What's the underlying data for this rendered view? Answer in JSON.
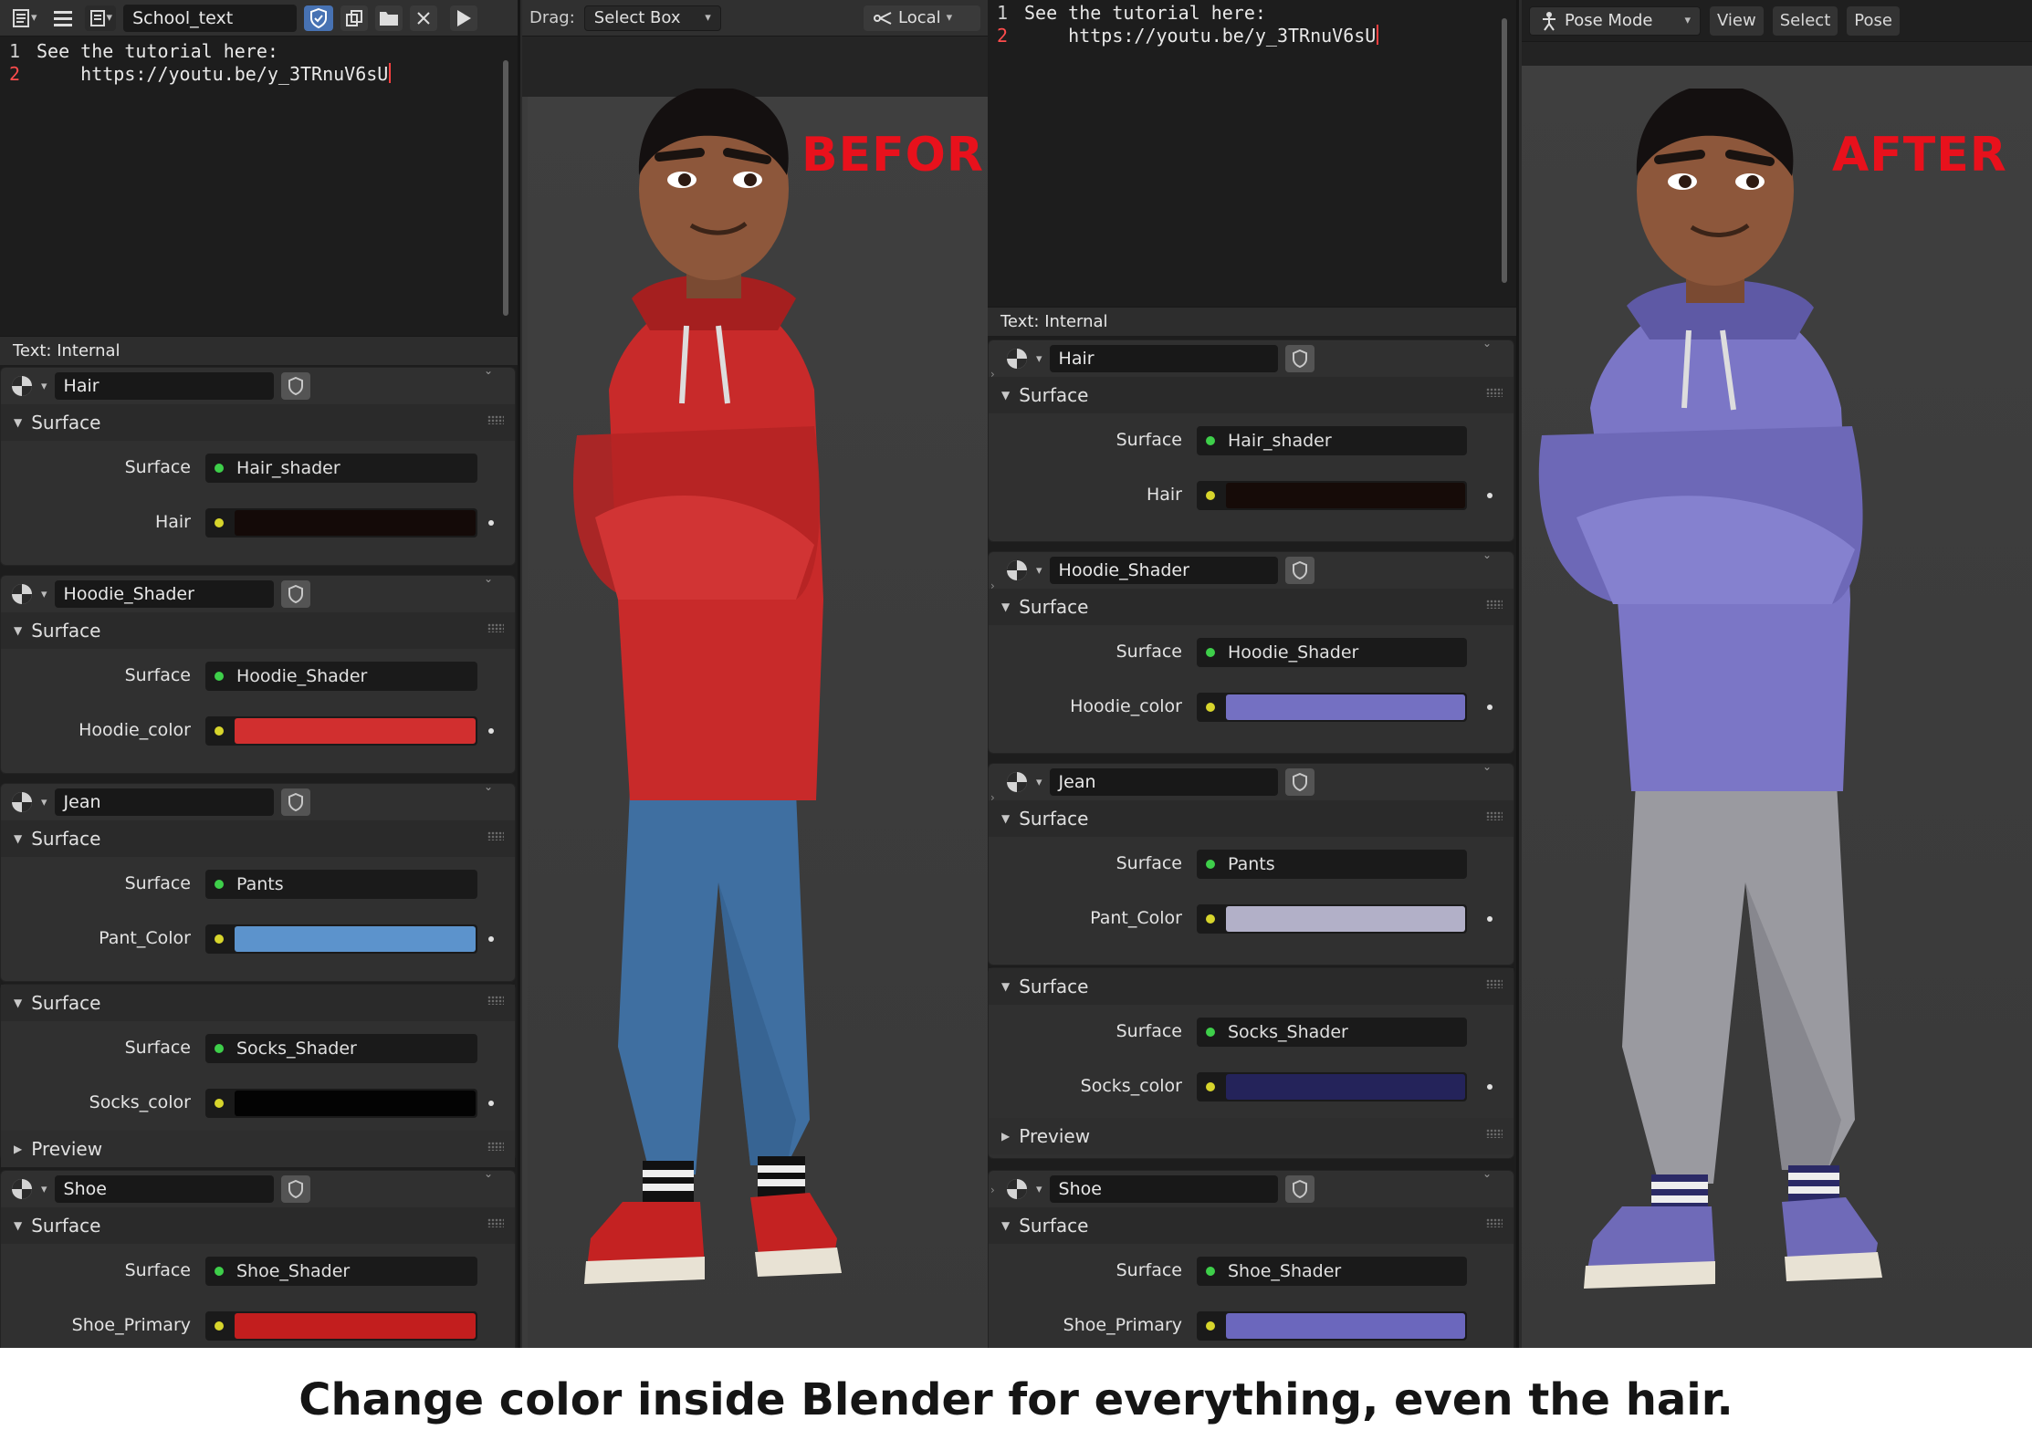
{
  "caption": "Change color inside Blender for everything, even the hair.",
  "before": {
    "headline": "BEFORE",
    "text_editor": {
      "filename": "School_text",
      "lines": [
        "See the tutorial here:",
        "    https://youtu.be/y_3TRnuV6sU"
      ],
      "line_numbers": [
        "1",
        "2"
      ],
      "status": "Text: Internal"
    },
    "viewport_header": {
      "drag_label": "Drag:",
      "select_mode": "Select Box",
      "orientation": "Local"
    },
    "materials": [
      {
        "name": "Hair",
        "surface_title": "Surface",
        "surface_label": "Surface",
        "surface_value": "Hair_shader",
        "color_label": "Hair",
        "color": "#140a08"
      },
      {
        "name": "Hoodie_Shader",
        "surface_title": "Surface",
        "surface_label": "Surface",
        "surface_value": "Hoodie_Shader",
        "color_label": "Hoodie_color",
        "color": "#d12f2f"
      },
      {
        "name": "Jean",
        "surface_title": "Surface",
        "surface_label": "Surface",
        "surface_value": "Pants",
        "color_label": "Pant_Color",
        "color": "#5c93cc"
      },
      {
        "surface_title": "Surface",
        "surface_label": "Surface",
        "surface_value": "Socks_Shader",
        "color_label": "Socks_color",
        "color": "#030303",
        "preview_label": "Preview"
      },
      {
        "name": "Shoe",
        "surface_title": "Surface",
        "surface_label": "Surface",
        "surface_value": "Shoe_Shader",
        "color_label": "Shoe_Primary",
        "color": "#c21e1e"
      }
    ],
    "character": {
      "hoodie": "#c82a2a",
      "hoodie_shade": "#9e1f1f",
      "pants": "#3e6fa0",
      "pants_shade": "#2f5a85",
      "shoe": "#c22222"
    }
  },
  "after": {
    "headline": "AFTER",
    "text_editor": {
      "lines": [
        "See the tutorial here:",
        "    https://youtu.be/y_3TRnuV6sU"
      ],
      "line_numbers": [
        "1",
        "2"
      ],
      "status": "Text: Internal"
    },
    "viewport_header": {
      "mode": "Pose Mode",
      "menus": [
        "View",
        "Select",
        "Pose"
      ]
    },
    "materials": [
      {
        "name": "Hair",
        "surface_title": "Surface",
        "surface_label": "Surface",
        "surface_value": "Hair_shader",
        "color_label": "Hair",
        "color": "#160b08"
      },
      {
        "name": "Hoodie_Shader",
        "surface_title": "Surface",
        "surface_label": "Surface",
        "surface_value": "Hoodie_Shader",
        "color_label": "Hoodie_color",
        "color": "#7470c2"
      },
      {
        "name": "Jean",
        "surface_title": "Surface",
        "surface_label": "Surface",
        "surface_value": "Pants",
        "color_label": "Pant_Color",
        "color": "#b2b0c8"
      },
      {
        "surface_title": "Surface",
        "surface_label": "Surface",
        "surface_value": "Socks_Shader",
        "color_label": "Socks_color",
        "color": "#24235a",
        "preview_label": "Preview"
      },
      {
        "name": "Shoe",
        "surface_title": "Surface",
        "surface_label": "Surface",
        "surface_value": "Shoe_Shader",
        "color_label": "Shoe_Primary",
        "color": "#6b67bd"
      }
    ],
    "character": {
      "hoodie": "#7b76c6",
      "hoodie_shade": "#5b57a3",
      "pants": "#9a9a9e",
      "pants_shade": "#7a7a80",
      "shoe": "#6f6ab8"
    }
  }
}
